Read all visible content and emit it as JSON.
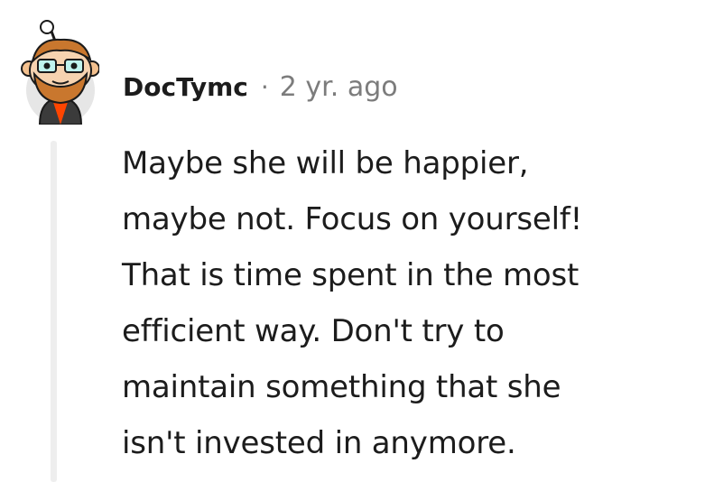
{
  "comment": {
    "username": "DocTymc",
    "separator": "·",
    "timestamp": "2 yr. ago",
    "body_lines": [
      "Maybe she will be happier,",
      "maybe not. Focus on yourself!",
      "That is time spent in the most",
      "efficient way. Don't try to",
      "maintain something that she",
      "isn't invested in anymore."
    ],
    "avatar_icon": "snoo-avatar-icon"
  },
  "colors": {
    "text": "#1c1c1c",
    "meta": "#7c7c7c",
    "thread_line": "#eeeeee"
  }
}
